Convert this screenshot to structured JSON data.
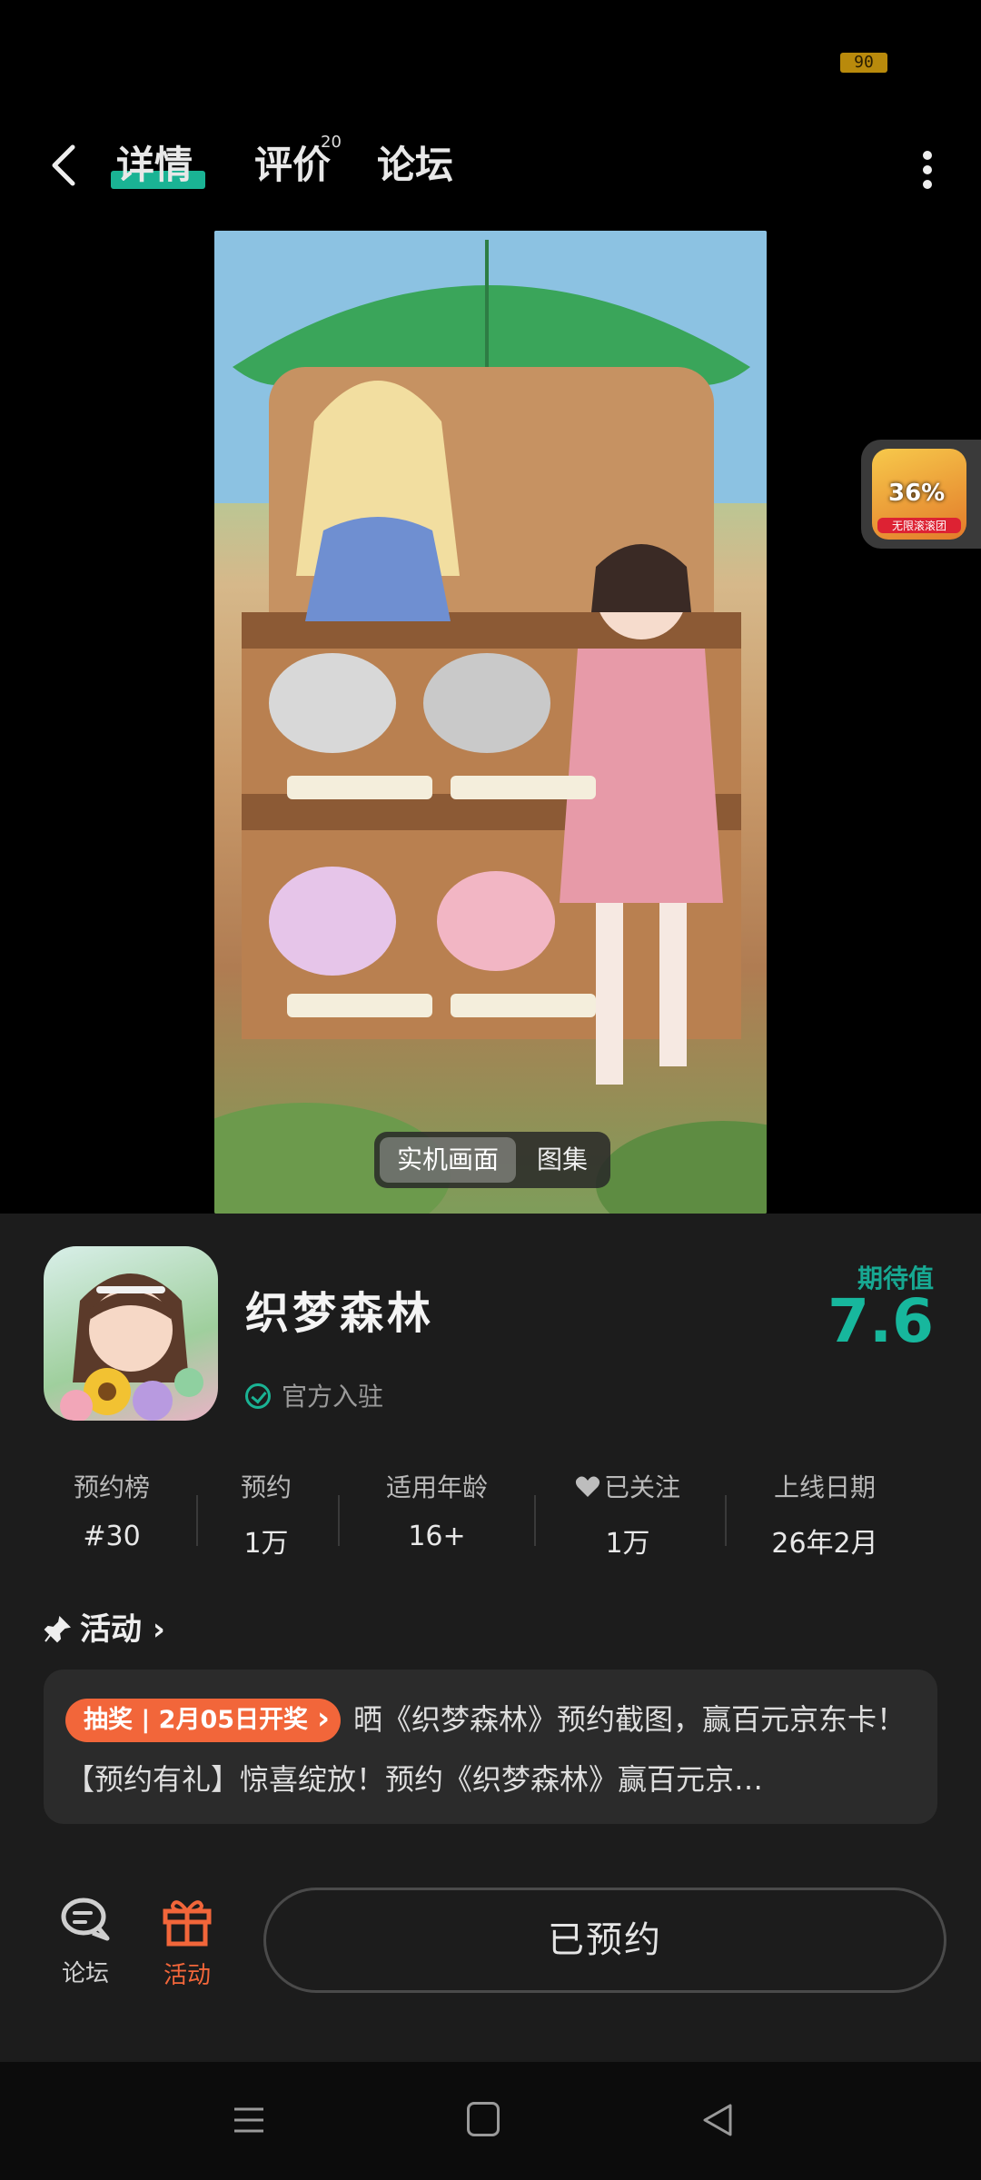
{
  "status": {
    "battery": "90"
  },
  "nav": {
    "tabs": [
      {
        "label": "详情",
        "active": true
      },
      {
        "label": "评价",
        "count": "20"
      },
      {
        "label": "论坛"
      }
    ]
  },
  "preview": {
    "tabs": [
      {
        "label": "实机画面",
        "selected": true
      },
      {
        "label": "图集"
      }
    ]
  },
  "float_widget": {
    "percent": "36%",
    "label": "无限滚滚团"
  },
  "app": {
    "name": "织梦森林",
    "official_label": "官方入驻",
    "expect_label": "期待值",
    "expect_value": "7.6"
  },
  "stats": [
    {
      "label": "预约榜",
      "value": "#30"
    },
    {
      "label": "预约",
      "value": "1万"
    },
    {
      "label": "适用年龄",
      "value": "16+"
    },
    {
      "label": "已关注",
      "value": "1万"
    },
    {
      "label": "上线日期",
      "value": "26年2月"
    }
  ],
  "activity": {
    "title": "活动",
    "tag": "抽奖 | 2月05日开奖",
    "text": "晒《织梦森林》预约截图，赢百元京东卡！【预约有礼】惊喜绽放！预约《织梦森林》赢百元京…"
  },
  "actions": {
    "forum_label": "论坛",
    "event_label": "活动",
    "reserve_label": "已预约"
  },
  "colors": {
    "accent": "#1ab394",
    "orange": "#f2663a",
    "panel": "#1c1c1c"
  }
}
